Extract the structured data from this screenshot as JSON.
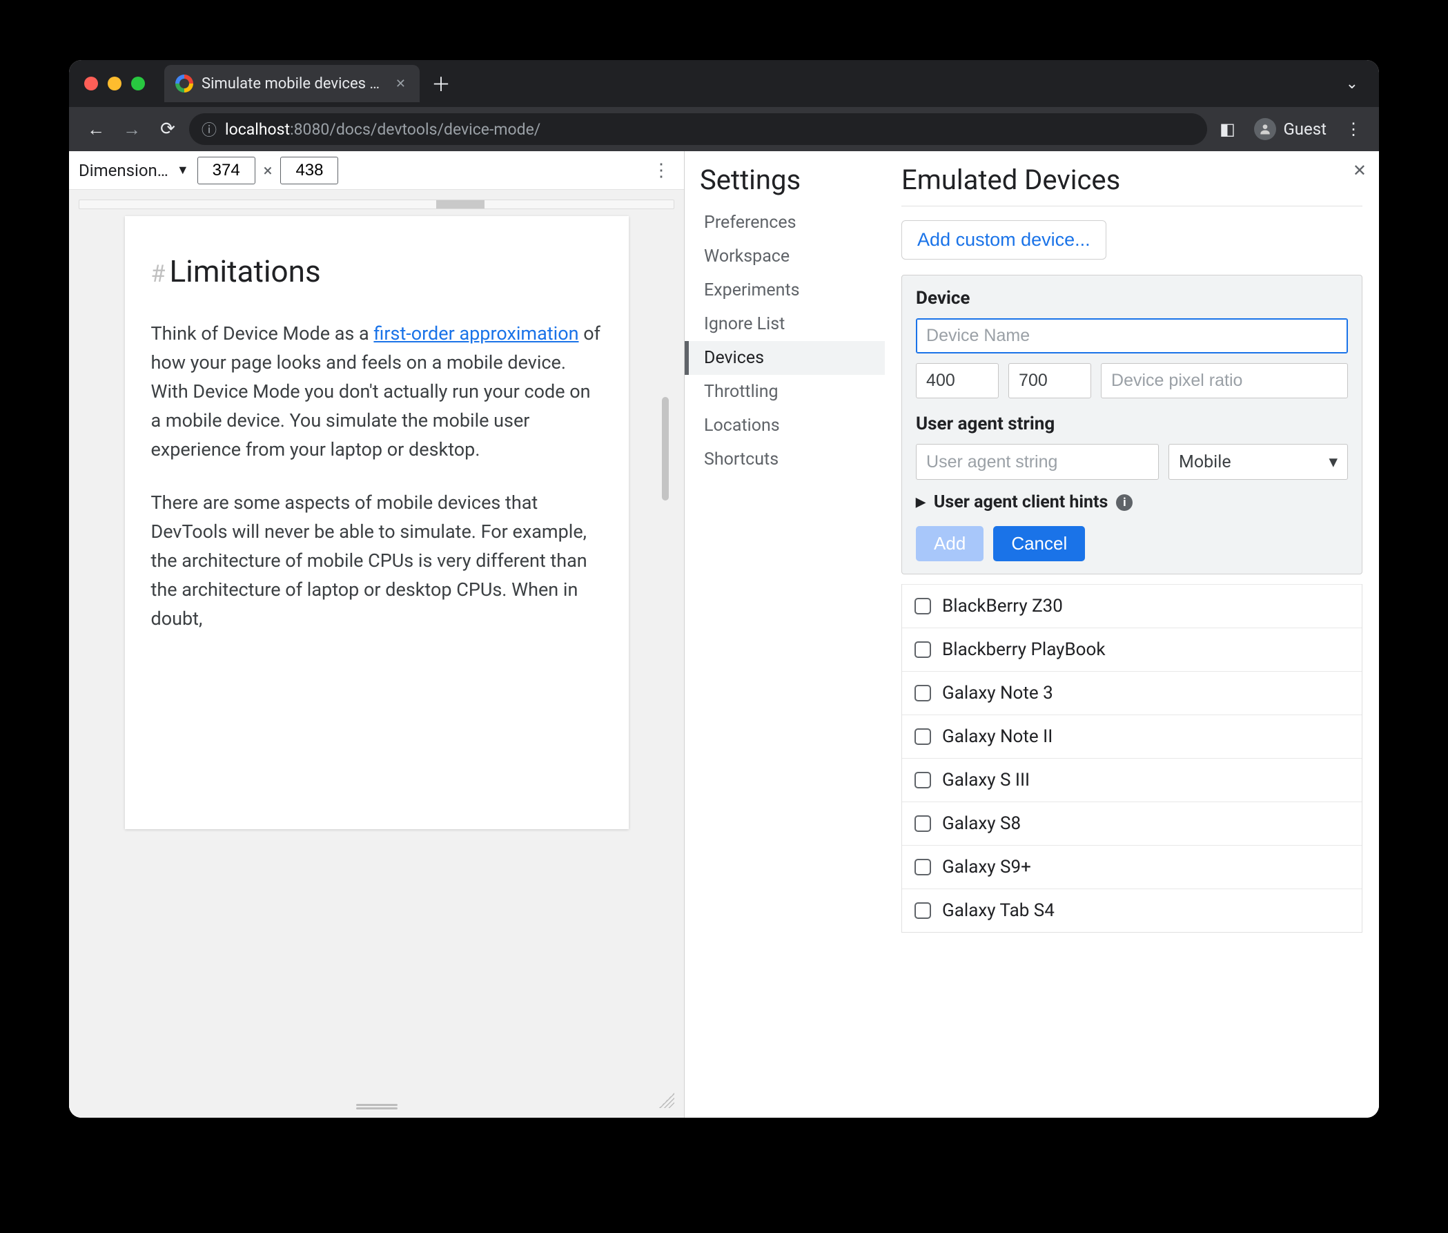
{
  "browser": {
    "tab_title": "Simulate mobile devices with D",
    "url_host": "localhost",
    "url_port": ":8080",
    "url_path": "/docs/devtools/device-mode/",
    "guest_label": "Guest"
  },
  "device_toolbar": {
    "label": "Dimension…",
    "width": "374",
    "height": "438",
    "times": "×"
  },
  "article": {
    "heading": "Limitations",
    "hash": "#",
    "p1a": "Think of Device Mode as a ",
    "p1_link": "first-order approximation",
    "p1b": " of how your page looks and feels on a mobile device. With Device Mode you don't actually run your code on a mobile device. You simulate the mobile user experience from your laptop or desktop.",
    "p2": "There are some aspects of mobile devices that DevTools will never be able to simulate. For example, the architecture of mobile CPUs is very different than the architecture of laptop or desktop CPUs. When in doubt,"
  },
  "settings": {
    "title": "Settings",
    "nav": [
      "Preferences",
      "Workspace",
      "Experiments",
      "Ignore List",
      "Devices",
      "Throttling",
      "Locations",
      "Shortcuts"
    ],
    "active_index": 4,
    "panel_title": "Emulated Devices",
    "add_custom": "Add custom device...",
    "device_section": "Device",
    "device_name_ph": "Device Name",
    "width_val": "400",
    "height_val": "700",
    "dpr_ph": "Device pixel ratio",
    "ua_section": "User agent string",
    "ua_string_ph": "User agent string",
    "ua_type": "Mobile",
    "client_hints": "User agent client hints",
    "add_btn": "Add",
    "cancel_btn": "Cancel",
    "devices": [
      "BlackBerry Z30",
      "Blackberry PlayBook",
      "Galaxy Note 3",
      "Galaxy Note II",
      "Galaxy S III",
      "Galaxy S8",
      "Galaxy S9+",
      "Galaxy Tab S4"
    ]
  }
}
